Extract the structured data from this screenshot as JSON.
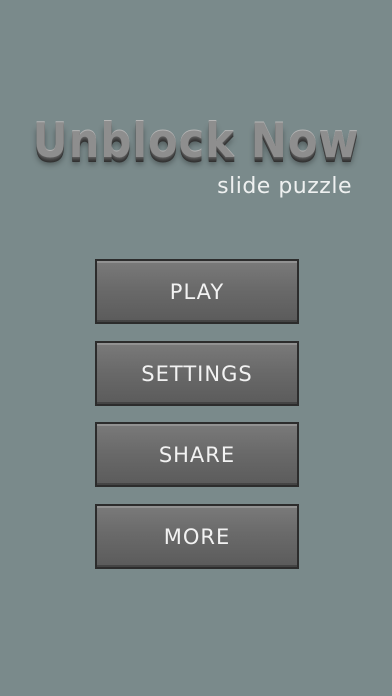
{
  "title": {
    "main": "Unblock Now",
    "subtitle": "slide puzzle"
  },
  "menu": {
    "play_label": "PLAY",
    "settings_label": "SETTINGS",
    "share_label": "SHARE",
    "more_label": "MORE"
  },
  "colors": {
    "background": "#7a8a8b",
    "button_fill": "#6a6a6a",
    "button_border": "#2c2c2c",
    "button_text": "#f2f2f2",
    "title_text": "#8e8e8e",
    "subtitle_text": "#eef0f0"
  }
}
